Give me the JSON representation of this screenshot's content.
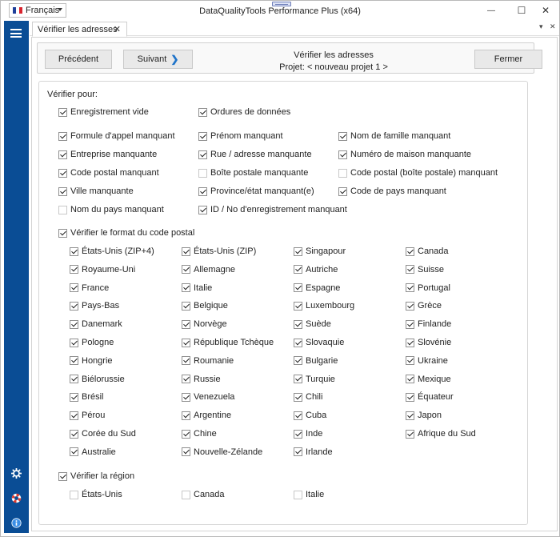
{
  "window": {
    "title": "DataQualityTools Performance Plus (x64)",
    "language": "Français",
    "minimize": "—",
    "maximize": "☐",
    "close": "✕"
  },
  "tab": {
    "label": "Vérifier les adresses",
    "close": "✕",
    "menu": "▾",
    "pin": "✕"
  },
  "toolbar": {
    "prev_label": "Précédent",
    "next_label": "Suivant",
    "next_arrow": "❯",
    "title_line1": "Vérifier les adresses",
    "title_line2": "Projet: < nouveau projet 1 >",
    "close_label": "Fermer"
  },
  "nav": {
    "icons": [
      "menu-icon",
      "gear-icon",
      "lifebuoy-icon",
      "info-icon"
    ],
    "color": "#0a4d95"
  },
  "check": {
    "title": "Vérifier pour:",
    "general": [
      {
        "label": "Enregistrement vide",
        "checked": true
      },
      {
        "label": "Ordures de données",
        "checked": true
      }
    ],
    "fields": [
      {
        "label": "Formule d'appel manquant",
        "checked": true
      },
      {
        "label": "Prénom manquant",
        "checked": true
      },
      {
        "label": "Nom de famille manquant",
        "checked": true
      },
      {
        "label": "Entreprise manquante",
        "checked": true
      },
      {
        "label": "Rue / adresse  manquante",
        "checked": true
      },
      {
        "label": "Numéro de maison manquante",
        "checked": true
      },
      {
        "label": "Code postal manquant",
        "checked": true
      },
      {
        "label": "Boîte postale manquante",
        "checked": false
      },
      {
        "label": "Code postal (boîte postale) manquant",
        "checked": false
      },
      {
        "label": "Ville manquante",
        "checked": true
      },
      {
        "label": "Province/état manquant(e)",
        "checked": true
      },
      {
        "label": "Code de pays manquant",
        "checked": true
      },
      {
        "label": "Nom du pays manquant",
        "checked": false
      },
      {
        "label": "ID / No d'enregistrement manquant",
        "checked": true
      }
    ]
  },
  "postal": {
    "title": "Vérifier le format du code postal",
    "checked": true,
    "countries": [
      {
        "label": "États-Unis (ZIP+4)",
        "checked": true
      },
      {
        "label": "États-Unis (ZIP)",
        "checked": true
      },
      {
        "label": "Singapour",
        "checked": true
      },
      {
        "label": "Canada",
        "checked": true
      },
      {
        "label": "Royaume-Uni",
        "checked": true
      },
      {
        "label": "Allemagne",
        "checked": true
      },
      {
        "label": "Autriche",
        "checked": true
      },
      {
        "label": "Suisse",
        "checked": true
      },
      {
        "label": "France",
        "checked": true
      },
      {
        "label": "Italie",
        "checked": true
      },
      {
        "label": "Espagne",
        "checked": true
      },
      {
        "label": "Portugal",
        "checked": true
      },
      {
        "label": "Pays-Bas",
        "checked": true
      },
      {
        "label": "Belgique",
        "checked": true
      },
      {
        "label": "Luxembourg",
        "checked": true
      },
      {
        "label": "Grèce",
        "checked": true
      },
      {
        "label": "Danemark",
        "checked": true
      },
      {
        "label": "Norvège",
        "checked": true
      },
      {
        "label": "Suède",
        "checked": true
      },
      {
        "label": "Finlande",
        "checked": true
      },
      {
        "label": "Pologne",
        "checked": true
      },
      {
        "label": "République Tchèque",
        "checked": true
      },
      {
        "label": "Slovaquie",
        "checked": true
      },
      {
        "label": "Slovénie",
        "checked": true
      },
      {
        "label": "Hongrie",
        "checked": true
      },
      {
        "label": "Roumanie",
        "checked": true
      },
      {
        "label": "Bulgarie",
        "checked": true
      },
      {
        "label": "Ukraine",
        "checked": true
      },
      {
        "label": "Biélorussie",
        "checked": true
      },
      {
        "label": "Russie",
        "checked": true
      },
      {
        "label": "Turquie",
        "checked": true
      },
      {
        "label": "Mexique",
        "checked": true
      },
      {
        "label": "Brésil",
        "checked": true
      },
      {
        "label": "Venezuela",
        "checked": true
      },
      {
        "label": "Chili",
        "checked": true
      },
      {
        "label": "Équateur",
        "checked": true
      },
      {
        "label": "Pérou",
        "checked": true
      },
      {
        "label": "Argentine",
        "checked": true
      },
      {
        "label": "Cuba",
        "checked": true
      },
      {
        "label": "Japon",
        "checked": true
      },
      {
        "label": "Corée du Sud",
        "checked": true
      },
      {
        "label": "Chine",
        "checked": true
      },
      {
        "label": "Inde",
        "checked": true
      },
      {
        "label": "Afrique du Sud",
        "checked": true
      },
      {
        "label": "Australie",
        "checked": true
      },
      {
        "label": "Nouvelle-Zélande",
        "checked": true
      },
      {
        "label": "Irlande",
        "checked": true
      }
    ]
  },
  "region": {
    "title": "Vérifier la région",
    "checked": true,
    "countries": [
      {
        "label": "États-Unis",
        "checked": false
      },
      {
        "label": "Canada",
        "checked": false
      },
      {
        "label": "Italie",
        "checked": false
      }
    ]
  }
}
